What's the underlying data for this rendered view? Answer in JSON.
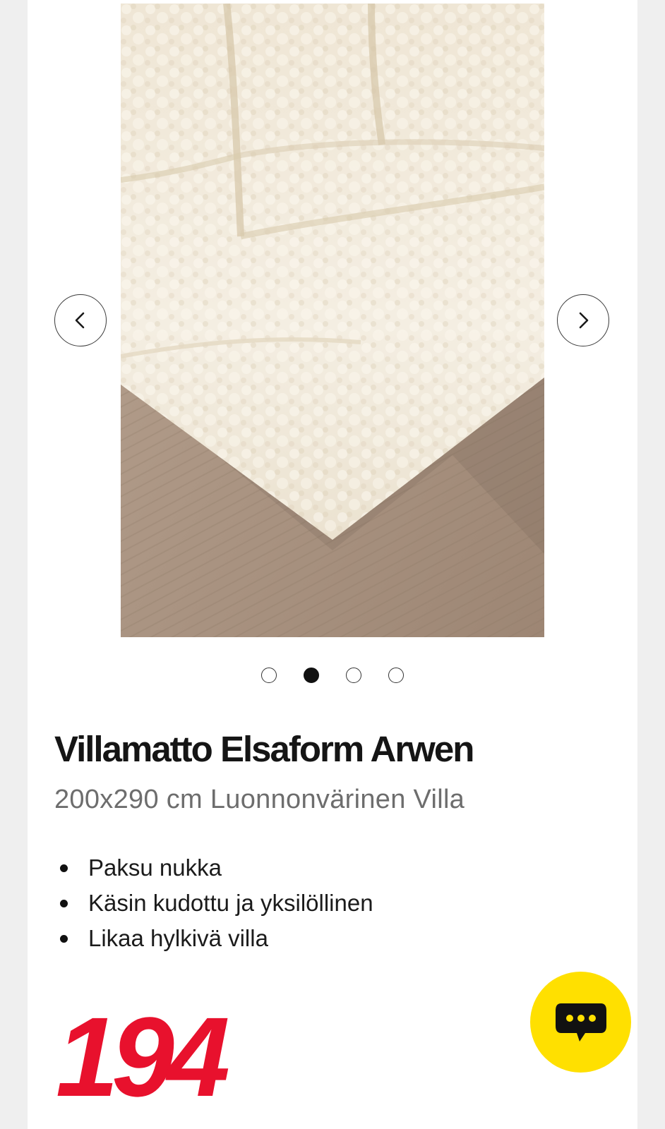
{
  "product": {
    "title": "Villamatto Elsaform Arwen",
    "subtitle": "200x290 cm Luonnonvärinen Villa",
    "features": [
      "Paksu nukka",
      "Käsin kudottu ja yksilöllinen",
      "Likaa hylkivä villa"
    ],
    "price": "194"
  },
  "gallery": {
    "image": "wool-rug-photo",
    "dots_total": 4,
    "active_dot": 2,
    "prev_icon": "chevron-left-icon",
    "next_icon": "chevron-right-icon"
  },
  "chat": {
    "icon": "chat-bubble-icon"
  },
  "colors": {
    "price_red": "#e8112d",
    "chat_yellow": "#ffe000",
    "rug_cream": "#f2ebdd",
    "floor_wood": "#a8927f"
  }
}
